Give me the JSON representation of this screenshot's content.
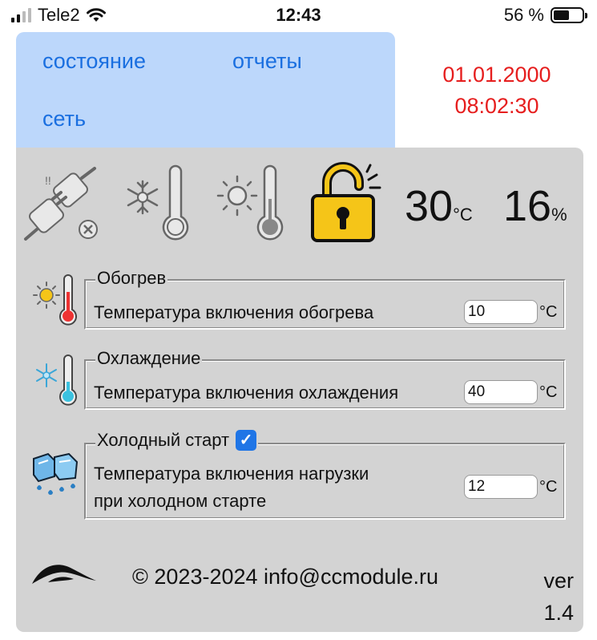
{
  "status_bar": {
    "carrier": "Tele2",
    "time": "12:43",
    "battery": "56 %",
    "battery_level": 0.56
  },
  "tabs": [
    {
      "label": "состояние",
      "active": true
    },
    {
      "label": "отчеты",
      "active": false
    },
    {
      "label": "сеть",
      "active": false
    }
  ],
  "datetime": {
    "date": "01.01.2000",
    "time": "08:02:30"
  },
  "readings": {
    "temperature": {
      "value": "30",
      "unit": "°C"
    },
    "humidity": {
      "value": "16",
      "unit": "%"
    }
  },
  "status_icons": [
    "power-disconnected-icon",
    "cold-thermometer-icon",
    "warm-thermometer-icon",
    "unlocked-padlock-icon"
  ],
  "groups": {
    "heating": {
      "title": "Обогрев",
      "label": "Температура включения обогрева",
      "value": "10",
      "unit": "°C"
    },
    "cooling": {
      "title": "Охлаждение",
      "label": "Температура включения охлаждения",
      "value": "40",
      "unit": "°C"
    },
    "cold_start": {
      "title": "Холодный старт",
      "checked": true,
      "label_line1": "Температура включения нагрузки",
      "label_line2": "при холодном старте",
      "value": "12",
      "unit": "°C"
    }
  },
  "footer": {
    "copyright": "© 2023-2024 info@ccmodule.ru",
    "version_label": "ver",
    "version": "1.4"
  },
  "colors": {
    "accent": "#1f75e6",
    "tab_bg": "#bcd7fb",
    "panel_bg": "#d3d3d3",
    "datetime": "#e61e1e",
    "lock": "#f5c518"
  }
}
